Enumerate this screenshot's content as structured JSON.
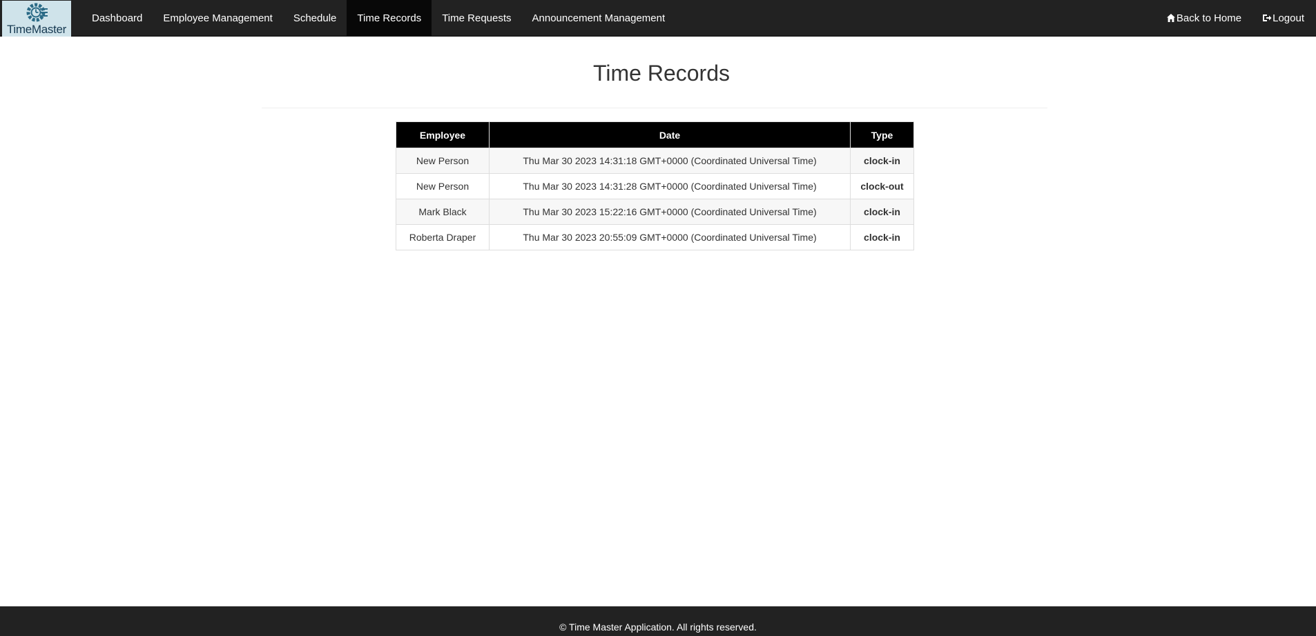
{
  "nav": {
    "brand": "TimeMaster",
    "items": [
      {
        "label": "Dashboard",
        "active": false
      },
      {
        "label": "Employee Management",
        "active": false
      },
      {
        "label": "Schedule",
        "active": false
      },
      {
        "label": "Time Records",
        "active": true
      },
      {
        "label": "Time Requests",
        "active": false
      },
      {
        "label": "Announcement Management",
        "active": false
      }
    ],
    "right": {
      "home_label": "Back to Home",
      "home_icon": "home-icon",
      "logout_label": "Logout",
      "logout_icon": "logout-icon"
    }
  },
  "page": {
    "title": "Time Records"
  },
  "table": {
    "headers": [
      "Employee",
      "Date",
      "Type"
    ],
    "rows": [
      {
        "employee": "New Person",
        "date": "Thu Mar 30 2023 14:31:18 GMT+0000 (Coordinated Universal Time)",
        "type": "clock-in"
      },
      {
        "employee": "New Person",
        "date": "Thu Mar 30 2023 14:31:28 GMT+0000 (Coordinated Universal Time)",
        "type": "clock-out"
      },
      {
        "employee": "Mark Black",
        "date": "Thu Mar 30 2023 15:22:16 GMT+0000 (Coordinated Universal Time)",
        "type": "clock-in"
      },
      {
        "employee": "Roberta Draper",
        "date": "Thu Mar 30 2023 20:55:09 GMT+0000 (Coordinated Universal Time)",
        "type": "clock-in"
      }
    ]
  },
  "colors": {
    "navbar": "#222222",
    "clock_in": "#008000",
    "clock_out": "#ff0000"
  },
  "footer": {
    "text": "© Time Master Application. All rights reserved."
  }
}
